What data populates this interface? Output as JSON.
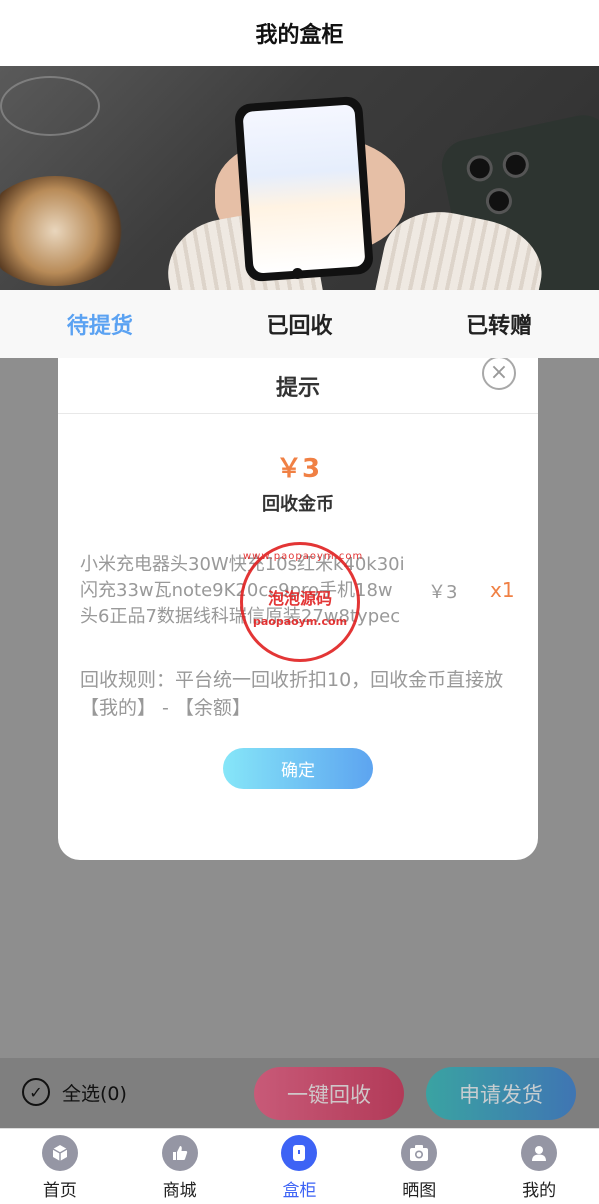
{
  "header": {
    "title": "我的盒柜"
  },
  "tabs": [
    {
      "label": "待提货",
      "active": true
    },
    {
      "label": "已回收",
      "active": false
    },
    {
      "label": "已转赠",
      "active": false
    }
  ],
  "dialog": {
    "title": "提示",
    "close_icon": "×",
    "price": "￥3",
    "coin_label": "回收金币",
    "product_name": "小米充电器头30W快充10s红米k40k30i闪充33w瓦note9K20cc9pro手机18w头6正品7数据线科瑞信原装27w8typec",
    "product_price": "￥3",
    "product_qty": "x1",
    "rule": "回收规则：平台统一回收折扣10，回收金币直接放【我的】 - 【余额】",
    "confirm_label": "确定"
  },
  "watermark": {
    "ring": "www.paopaoym.com",
    "center": "泡泡源码",
    "bottom": "paopaoym.com"
  },
  "action_bar": {
    "select_all": "全选(0)",
    "recycle_all": "一键回收",
    "apply_ship": "申请发货"
  },
  "tabbar": [
    {
      "label": "首页",
      "icon": "box-icon",
      "active": false
    },
    {
      "label": "商城",
      "icon": "thumb-icon",
      "active": false
    },
    {
      "label": "盒柜",
      "icon": "cabinet-icon",
      "active": true
    },
    {
      "label": "晒图",
      "icon": "camera-icon",
      "active": false
    },
    {
      "label": "我的",
      "icon": "user-icon",
      "active": false
    }
  ],
  "colors": {
    "accent": "#5ba2f2",
    "orange": "#f08044",
    "tab_active": "#3d63f5"
  }
}
